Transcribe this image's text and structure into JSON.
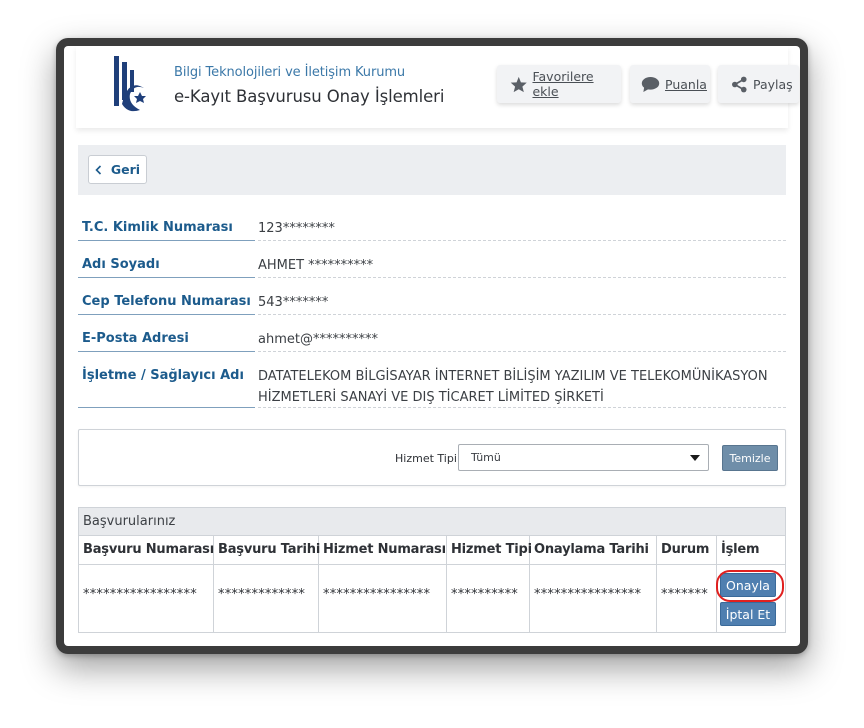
{
  "header": {
    "org_name": "Bilgi Teknolojileri ve İletişim Kurumu",
    "page_title": "e-Kayıt Başvurusu Onay İşlemleri",
    "favorites_label": "Favorilere ekle",
    "rate_label": "Puanla",
    "share_label": "Paylaş"
  },
  "back_label": "Geri",
  "info": [
    {
      "label": "T.C. Kimlik Numarası",
      "value": "123********"
    },
    {
      "label": "Adı Soyadı",
      "value": "AHMET **********"
    },
    {
      "label": "Cep Telefonu Numarası",
      "value": "543*******"
    },
    {
      "label": "E-Posta Adresi",
      "value": "ahmet@**********"
    },
    {
      "label": "İşletme / Sağlayıcı Adı",
      "value": "DATATELEKOM BİLGİSAYAR İNTERNET BİLİŞİM YAZILIM VE TELEKOMÜNİKASYON HİZMETLERİ SANAYİ VE DIŞ TİCARET LİMİTED ŞİRKETİ"
    }
  ],
  "filter": {
    "label": "Hizmet Tipi",
    "selected": "Tümü",
    "clear_label": "Temizle"
  },
  "applications": {
    "title": "Başvurularınız",
    "columns": [
      "Başvuru Numarası",
      "Başvuru Tarihi",
      "Hizmet Numarası",
      "Hizmet Tipi",
      "Onaylama Tarihi",
      "Durum",
      "İşlem"
    ],
    "row": [
      "*****************",
      "*************",
      "****************",
      "**********",
      "****************",
      "*******"
    ],
    "approve_label": "Onayla",
    "cancel_label": "İptal Et"
  },
  "colors": {
    "accent": "#1c5b8c",
    "button": "#4f7fb0",
    "highlight": "#e0201f"
  }
}
